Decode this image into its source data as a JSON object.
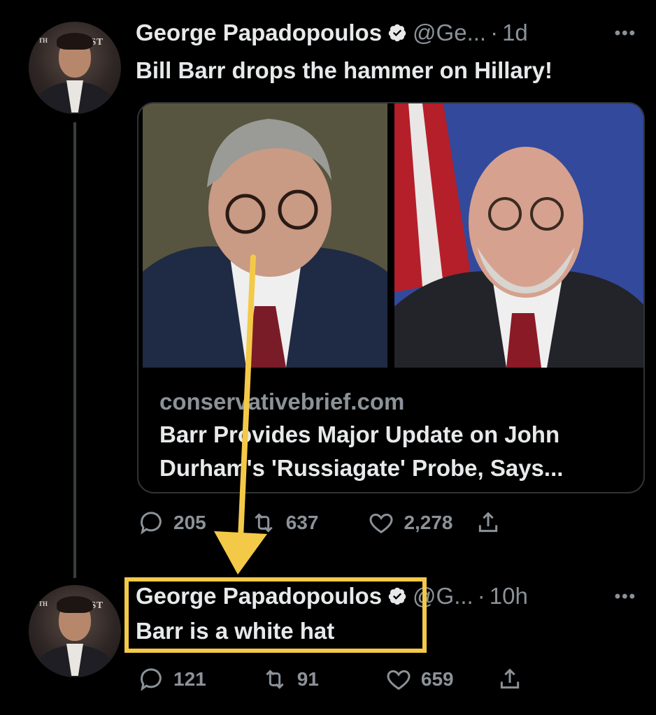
{
  "tweet1": {
    "author_name": "George Papadopoulos",
    "handle": "@Ge...",
    "separator": "·",
    "time": "1d",
    "more_label": "•••",
    "text": "Bill Barr drops the hammer on Hillary!",
    "avatar_text": "NIST",
    "card": {
      "domain": "conservativebrief.com",
      "title": "Barr Provides Major Update on John Durham's 'Russiagate' Probe, Says..."
    },
    "actions": {
      "reply_count": "205",
      "retweet_count": "637",
      "like_count": "2,278"
    }
  },
  "tweet2": {
    "author_name": "George Papadopoulos",
    "handle": "@G...",
    "separator": "·",
    "time": "10h",
    "more_label": "•••",
    "text": "Barr is a white hat",
    "avatar_text": "NIST",
    "actions": {
      "reply_count": "121",
      "retweet_count": "91",
      "like_count": "659"
    }
  },
  "icons": {
    "verified": "verified-badge-icon",
    "reply": "reply-icon",
    "retweet": "retweet-icon",
    "like": "heart-icon",
    "share": "share-icon"
  },
  "colors": {
    "background": "#000000",
    "text": "#e7e9ea",
    "secondary": "#8b9298",
    "annotation": "#f4c948"
  }
}
